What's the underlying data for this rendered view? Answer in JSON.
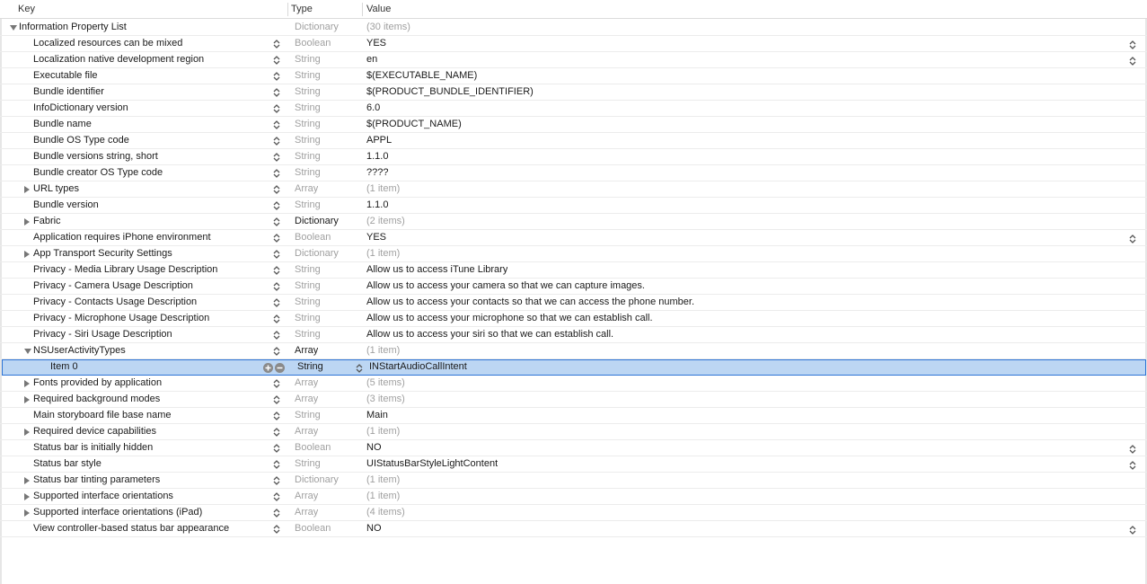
{
  "header": {
    "key": "Key",
    "type": "Type",
    "value": "Value"
  },
  "colors": {
    "selection": "#bcd6f3",
    "selection_border": "#2d74d6",
    "dim_text": "#a0a0a0"
  },
  "rows": [
    {
      "key": "Information Property List",
      "type": "Dictionary",
      "value": "(30 items)",
      "disclosure": "expanded",
      "indent": 0,
      "stepper": false,
      "typeDim": true,
      "valueDim": true,
      "valueStepper": false
    },
    {
      "key": "Localized resources can be mixed",
      "type": "Boolean",
      "value": "YES",
      "disclosure": "none",
      "indent": 1,
      "stepper": true,
      "typeDim": true,
      "valueDim": false,
      "valueStepper": true
    },
    {
      "key": "Localization native development region",
      "type": "String",
      "value": "en",
      "disclosure": "none",
      "indent": 1,
      "stepper": true,
      "typeDim": true,
      "valueDim": false,
      "valueStepper": true
    },
    {
      "key": "Executable file",
      "type": "String",
      "value": "$(EXECUTABLE_NAME)",
      "disclosure": "none",
      "indent": 1,
      "stepper": true,
      "typeDim": true,
      "valueDim": false,
      "valueStepper": false
    },
    {
      "key": "Bundle identifier",
      "type": "String",
      "value": "$(PRODUCT_BUNDLE_IDENTIFIER)",
      "disclosure": "none",
      "indent": 1,
      "stepper": true,
      "typeDim": true,
      "valueDim": false,
      "valueStepper": false
    },
    {
      "key": "InfoDictionary version",
      "type": "String",
      "value": "6.0",
      "disclosure": "none",
      "indent": 1,
      "stepper": true,
      "typeDim": true,
      "valueDim": false,
      "valueStepper": false
    },
    {
      "key": "Bundle name",
      "type": "String",
      "value": "$(PRODUCT_NAME)",
      "disclosure": "none",
      "indent": 1,
      "stepper": true,
      "typeDim": true,
      "valueDim": false,
      "valueStepper": false
    },
    {
      "key": "Bundle OS Type code",
      "type": "String",
      "value": "APPL",
      "disclosure": "none",
      "indent": 1,
      "stepper": true,
      "typeDim": true,
      "valueDim": false,
      "valueStepper": false
    },
    {
      "key": "Bundle versions string, short",
      "type": "String",
      "value": "1.1.0",
      "disclosure": "none",
      "indent": 1,
      "stepper": true,
      "typeDim": true,
      "valueDim": false,
      "valueStepper": false
    },
    {
      "key": "Bundle creator OS Type code",
      "type": "String",
      "value": "????",
      "disclosure": "none",
      "indent": 1,
      "stepper": true,
      "typeDim": true,
      "valueDim": false,
      "valueStepper": false
    },
    {
      "key": "URL types",
      "type": "Array",
      "value": "(1 item)",
      "disclosure": "collapsed",
      "indent": 1,
      "stepper": true,
      "typeDim": true,
      "valueDim": true,
      "valueStepper": false
    },
    {
      "key": "Bundle version",
      "type": "String",
      "value": "1.1.0",
      "disclosure": "none",
      "indent": 1,
      "stepper": true,
      "typeDim": true,
      "valueDim": false,
      "valueStepper": false
    },
    {
      "key": "Fabric",
      "type": "Dictionary",
      "value": "(2 items)",
      "disclosure": "collapsed",
      "indent": 1,
      "stepper": true,
      "typeDim": false,
      "valueDim": true,
      "valueStepper": false
    },
    {
      "key": "Application requires iPhone environment",
      "type": "Boolean",
      "value": "YES",
      "disclosure": "none",
      "indent": 1,
      "stepper": true,
      "typeDim": true,
      "valueDim": false,
      "valueStepper": true
    },
    {
      "key": "App Transport Security Settings",
      "type": "Dictionary",
      "value": "(1 item)",
      "disclosure": "collapsed",
      "indent": 1,
      "stepper": true,
      "typeDim": true,
      "valueDim": true,
      "valueStepper": false
    },
    {
      "key": "Privacy - Media Library Usage Description",
      "type": "String",
      "value": "Allow us to access iTune Library",
      "disclosure": "none",
      "indent": 1,
      "stepper": true,
      "typeDim": true,
      "valueDim": false,
      "valueStepper": false
    },
    {
      "key": "Privacy - Camera Usage Description",
      "type": "String",
      "value": "Allow us to access your camera so that we can capture images.",
      "disclosure": "none",
      "indent": 1,
      "stepper": true,
      "typeDim": true,
      "valueDim": false,
      "valueStepper": false
    },
    {
      "key": "Privacy - Contacts Usage Description",
      "type": "String",
      "value": "Allow us to access your contacts so that we can access the phone number.",
      "disclosure": "none",
      "indent": 1,
      "stepper": true,
      "typeDim": true,
      "valueDim": false,
      "valueStepper": false
    },
    {
      "key": "Privacy - Microphone Usage Description",
      "type": "String",
      "value": "Allow us to access your microphone so that we can establish call.",
      "disclosure": "none",
      "indent": 1,
      "stepper": true,
      "typeDim": true,
      "valueDim": false,
      "valueStepper": false
    },
    {
      "key": "Privacy - Siri Usage Description",
      "type": "String",
      "value": "Allow us to access your siri so that we can establish call.",
      "disclosure": "none",
      "indent": 1,
      "stepper": true,
      "typeDim": true,
      "valueDim": false,
      "valueStepper": false
    },
    {
      "key": "NSUserActivityTypes",
      "type": "Array",
      "value": "(1 item)",
      "disclosure": "expanded",
      "indent": 1,
      "stepper": true,
      "typeDim": false,
      "valueDim": true,
      "valueStepper": false
    },
    {
      "key": "Item 0",
      "type": "String",
      "value": "INStartAudioCallIntent",
      "disclosure": "none",
      "indent": 2,
      "stepper": false,
      "typeDim": false,
      "valueDim": false,
      "valueStepper": false,
      "selected": true
    },
    {
      "key": "Fonts provided by application",
      "type": "Array",
      "value": "(5 items)",
      "disclosure": "collapsed",
      "indent": 1,
      "stepper": true,
      "typeDim": true,
      "valueDim": true,
      "valueStepper": false
    },
    {
      "key": "Required background modes",
      "type": "Array",
      "value": "(3 items)",
      "disclosure": "collapsed",
      "indent": 1,
      "stepper": true,
      "typeDim": true,
      "valueDim": true,
      "valueStepper": false
    },
    {
      "key": "Main storyboard file base name",
      "type": "String",
      "value": "Main",
      "disclosure": "none",
      "indent": 1,
      "stepper": true,
      "typeDim": true,
      "valueDim": false,
      "valueStepper": false
    },
    {
      "key": "Required device capabilities",
      "type": "Array",
      "value": "(1 item)",
      "disclosure": "collapsed",
      "indent": 1,
      "stepper": true,
      "typeDim": true,
      "valueDim": true,
      "valueStepper": false
    },
    {
      "key": "Status bar is initially hidden",
      "type": "Boolean",
      "value": "NO",
      "disclosure": "none",
      "indent": 1,
      "stepper": true,
      "typeDim": true,
      "valueDim": false,
      "valueStepper": true
    },
    {
      "key": "Status bar style",
      "type": "String",
      "value": "UIStatusBarStyleLightContent",
      "disclosure": "none",
      "indent": 1,
      "stepper": true,
      "typeDim": true,
      "valueDim": false,
      "valueStepper": true
    },
    {
      "key": "Status bar tinting parameters",
      "type": "Dictionary",
      "value": "(1 item)",
      "disclosure": "collapsed",
      "indent": 1,
      "stepper": true,
      "typeDim": true,
      "valueDim": true,
      "valueStepper": false
    },
    {
      "key": "Supported interface orientations",
      "type": "Array",
      "value": "(1 item)",
      "disclosure": "collapsed",
      "indent": 1,
      "stepper": true,
      "typeDim": true,
      "valueDim": true,
      "valueStepper": false
    },
    {
      "key": "Supported interface orientations (iPad)",
      "type": "Array",
      "value": "(4 items)",
      "disclosure": "collapsed",
      "indent": 1,
      "stepper": true,
      "typeDim": true,
      "valueDim": true,
      "valueStepper": false
    },
    {
      "key": "View controller-based status bar appearance",
      "type": "Boolean",
      "value": "NO",
      "disclosure": "none",
      "indent": 1,
      "stepper": true,
      "typeDim": true,
      "valueDim": false,
      "valueStepper": true
    }
  ]
}
